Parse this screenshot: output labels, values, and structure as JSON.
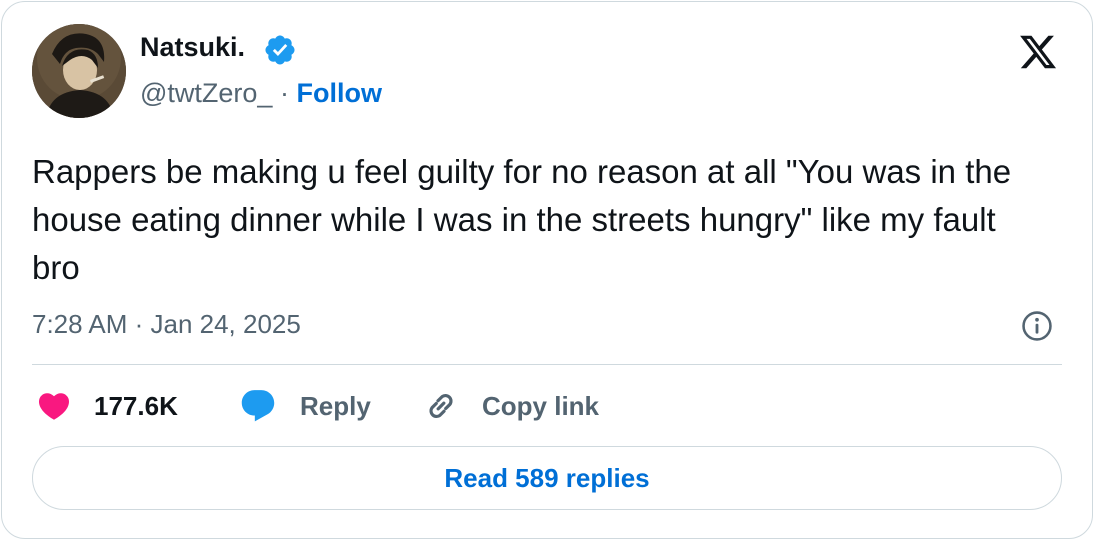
{
  "user": {
    "display_name": "Natsuki.",
    "handle": "@twtZero_",
    "separator": "·",
    "follow_label": "Follow",
    "verified_icon": "verified-badge-icon",
    "avatar_icon": "avatar"
  },
  "tweet": {
    "text": "Rappers be making u feel guilty for no reason at all \"You was in the house eating dinner while I was in the streets hungry\" like my fault bro",
    "timestamp": "7:28 AM · Jan 24, 2025"
  },
  "actions": {
    "likes": "177.6K",
    "reply_label": "Reply",
    "copy_link_label": "Copy link"
  },
  "read_replies_label": "Read 589 replies",
  "colors": {
    "accent": "#006fd6",
    "verified": "#1d9bf0",
    "like": "#f91880",
    "secondary_text": "#536471",
    "border": "#cfd9de"
  }
}
